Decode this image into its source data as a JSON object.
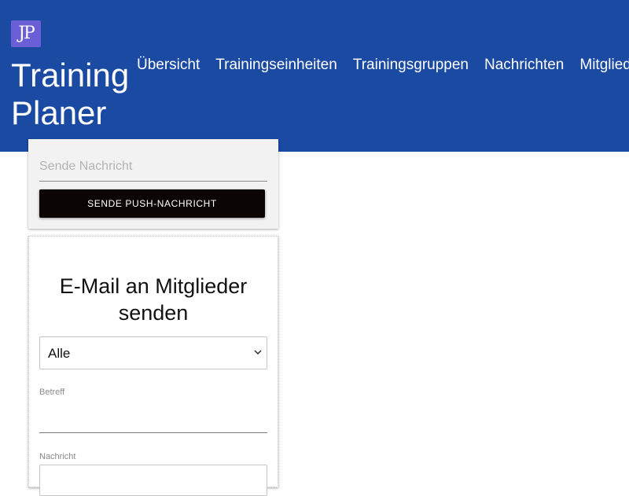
{
  "header": {
    "logo_text": "JP",
    "brand_line1": "Training",
    "brand_line2": "Planer",
    "nav": [
      "Übersicht",
      "Trainingseinheiten",
      "Trainingsgruppen",
      "Nachrichten",
      "Mitglieder"
    ],
    "background_color": "#1b4aa3"
  },
  "push": {
    "placeholder": "Sende Nachricht",
    "button_label": "SENDE PUSH-NACHRICHT"
  },
  "mail": {
    "title": "E-Mail an Mitglieder senden",
    "recipient_selected": "Alle",
    "subject_label": "Betreff",
    "message_label": "Nachricht"
  }
}
